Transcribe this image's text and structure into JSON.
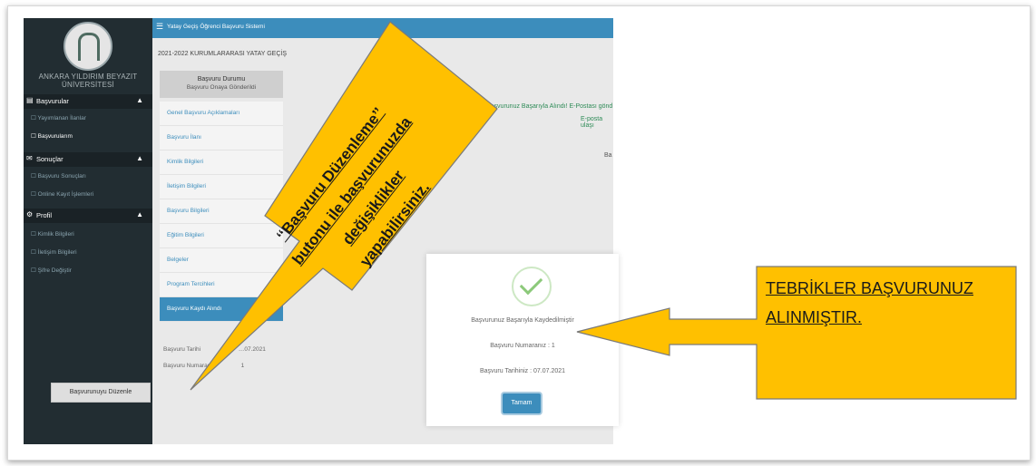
{
  "app": {
    "topbar_title": "Yatay Geçiş Öğrenci Başvuru Sistemi",
    "university": "ANKARA YILDIRIM BEYAZIT ÜNİVERSİTESİ",
    "breadcrumb": "2021-2022 KURUMLARARASI YATAY GEÇİŞ"
  },
  "sidebar": {
    "sections": [
      {
        "label": "Başvurular",
        "items": [
          "Yayımlanan İlanlar",
          "Başvurularım"
        ]
      },
      {
        "label": "Sonuçlar",
        "items": [
          "Başvuru Sonuçları",
          "Online Kayıt İşlemleri"
        ]
      },
      {
        "label": "Profil",
        "items": [
          "Kimlik Bilgileri",
          "İletişim Bilgileri",
          "Şifre Değiştir"
        ]
      }
    ]
  },
  "status": {
    "title": "Başvuru Durumu",
    "value": "Başvuru Onaya Gönderildi"
  },
  "menu": [
    "Genel Başvuru Açıklamaları",
    "Başvuru İlanı",
    "Kimlik Bilgileri",
    "İletişim Bilgileri",
    "Başvuru Bilgileri",
    "Eğitim Bilgileri",
    "Belgeler",
    "Program Tercihleri",
    "Başvuru Kaydı Alındı"
  ],
  "info": {
    "date_label": "Başvuru Tarihi",
    "date_value": "…07.2021",
    "number_label": "Başvuru Numarası",
    "number_value": "1"
  },
  "edit_button": "Başvurunuyu Düzenle",
  "green_message_1": "Başvurunuz Başarıyla Alındı! E-Postası gönd",
  "green_message_2": "E-posta ulaşı",
  "right_text": "Ba",
  "modal": {
    "line1": "Başvurunuz Başarıyla Kaydedilmiştir",
    "line2": "Başvuru Numaranız : 1",
    "line3": "Başvuru Tarihiniz : 07.07.2021",
    "ok": "Tamam"
  },
  "callouts": {
    "left": [
      "‘‘Başvuru Düzenleme’’",
      "butonu ile başvurunuzda",
      "değişiklikler",
      "yapabilirsiniz."
    ],
    "right": [
      "TEBRİKLER BAŞVURUNUZ",
      "ALINMIŞTIR."
    ]
  },
  "colors": {
    "callout": "#ffc000",
    "sidebar": "#222d32",
    "accent": "#3c8dbc"
  }
}
